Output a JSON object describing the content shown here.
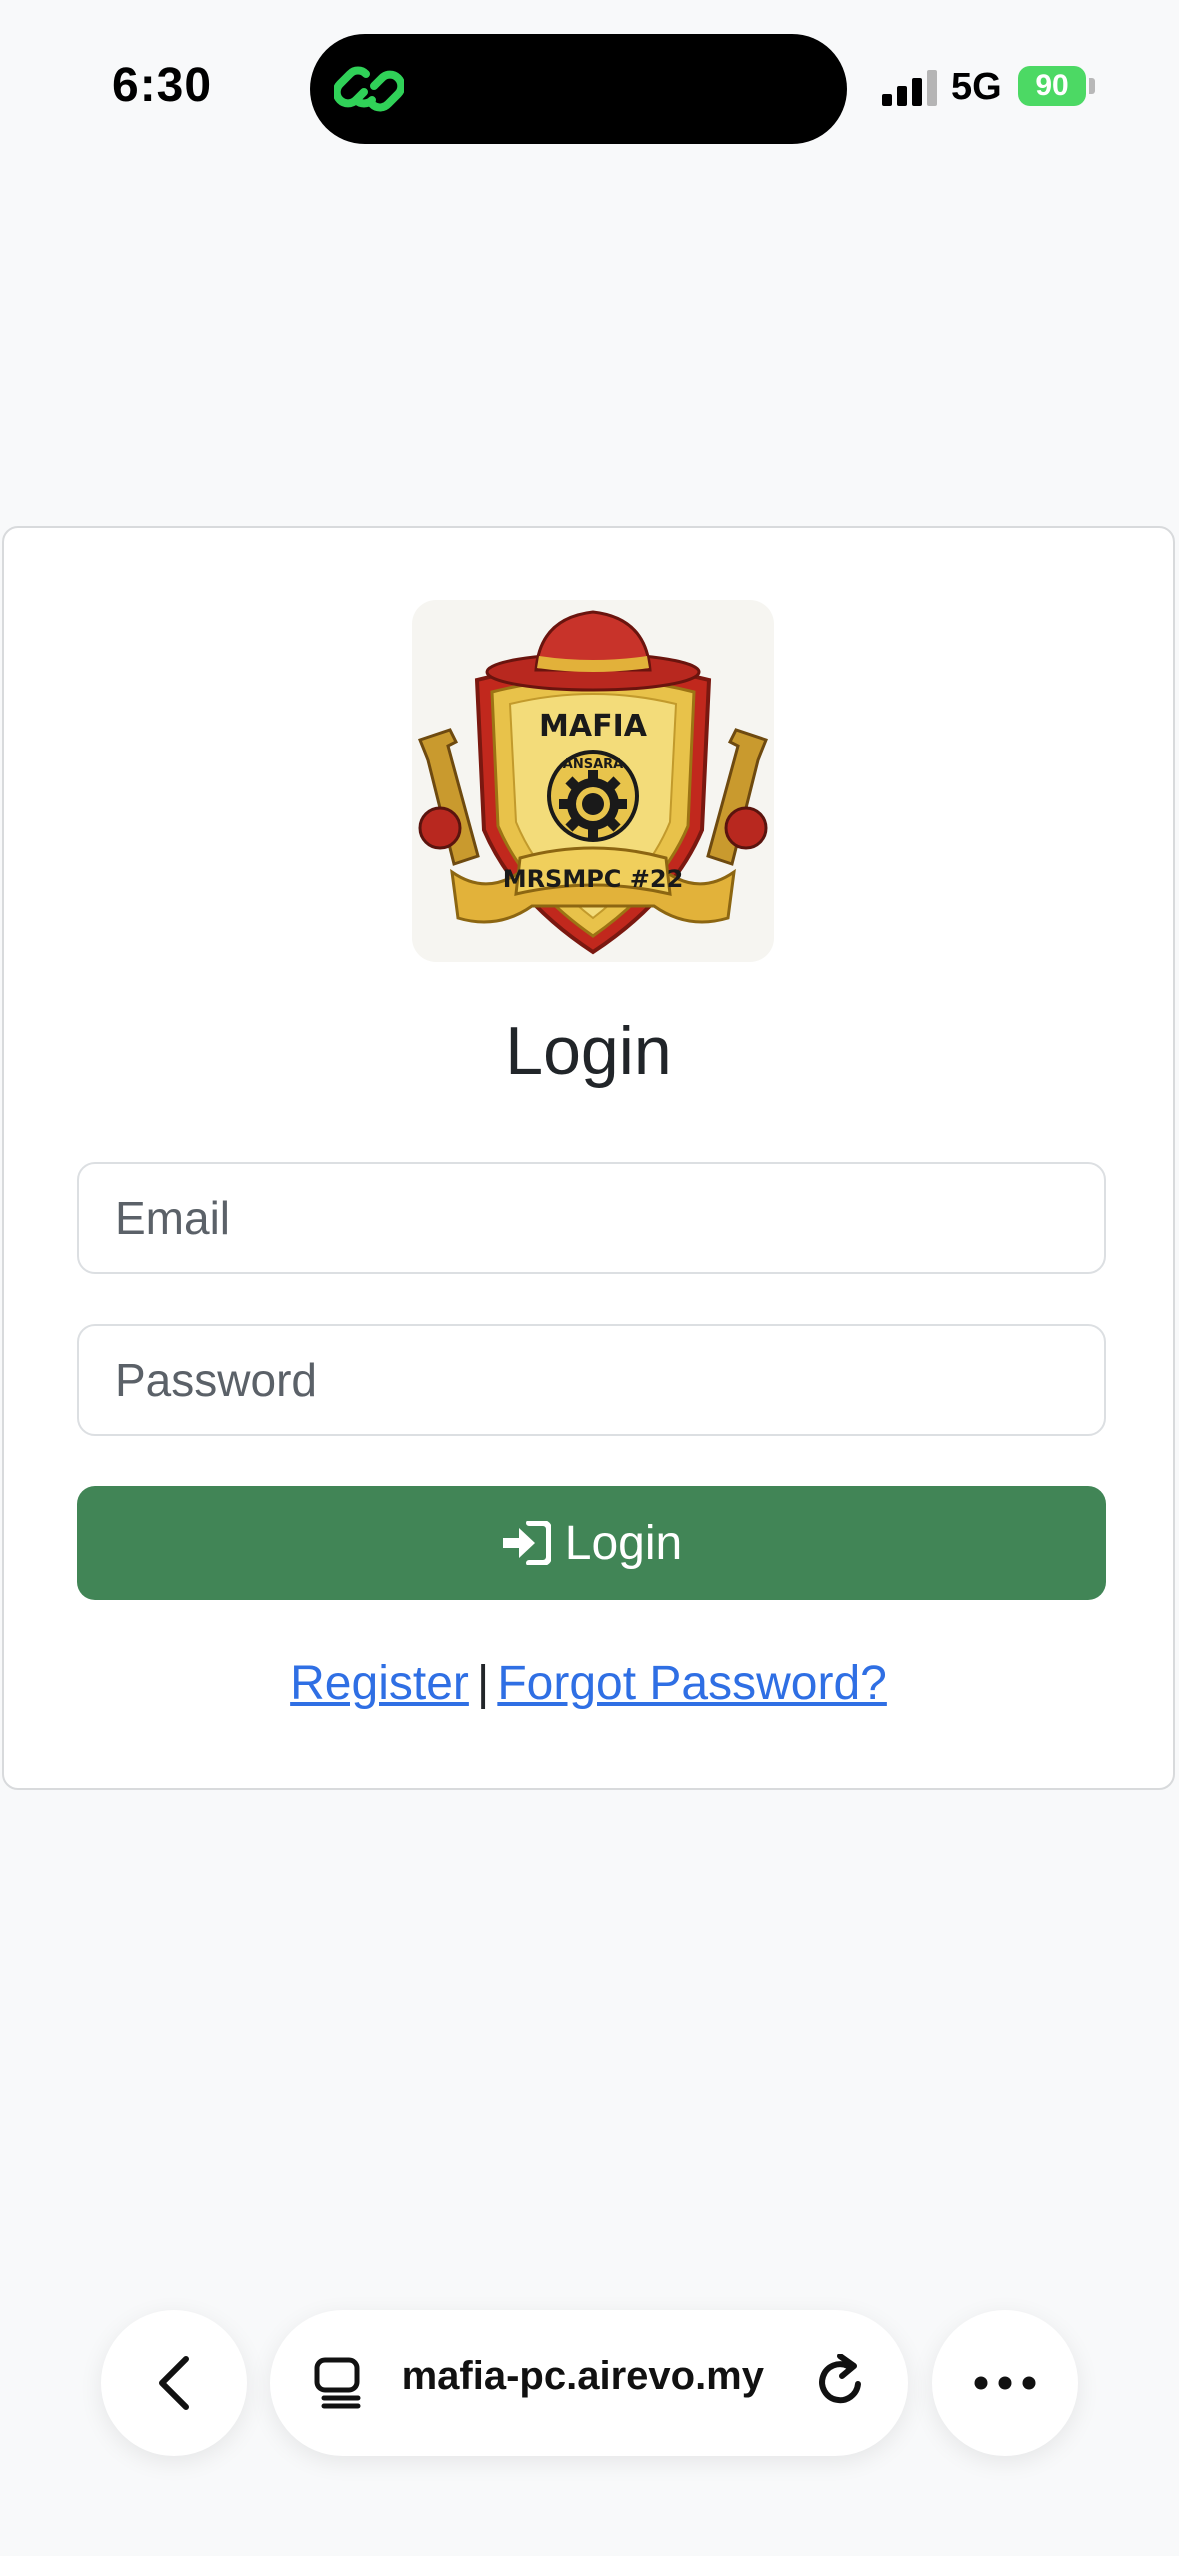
{
  "status_bar": {
    "time": "6:30",
    "network": "5G",
    "battery": "90",
    "icons": [
      "link-icon",
      "signal-icon",
      "battery-icon"
    ],
    "colors": {
      "app_icon": "#30d158",
      "battery": "#4cd964"
    }
  },
  "login": {
    "logo_text": {
      "top": "MAFIA",
      "center": "ANSARA",
      "banner": "MRSMPC #22"
    },
    "title": "Login",
    "email_placeholder": "Email",
    "password_placeholder": "Password",
    "submit_label": "Login",
    "submit_icon": "sign-in-icon",
    "register_link": "Register",
    "separator": "|",
    "forgot_link": "Forgot Password?",
    "colors": {
      "button": "#418556",
      "link": "#2f6fe4"
    }
  },
  "browser": {
    "url": "mafia-pc.airevo.my",
    "icons": [
      "back-chevron-icon",
      "tabs-icon",
      "reload-icon",
      "more-icon"
    ]
  }
}
